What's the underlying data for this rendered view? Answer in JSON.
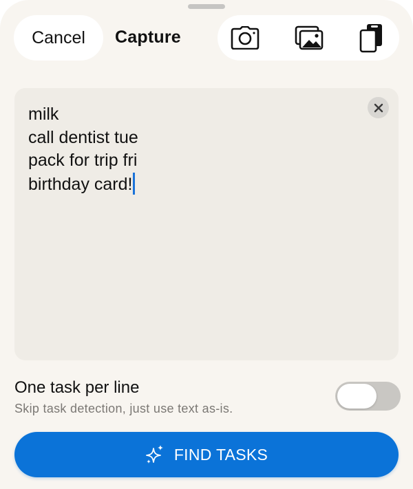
{
  "header": {
    "cancel_label": "Cancel",
    "title": "Capture",
    "tools": [
      {
        "name": "camera-icon"
      },
      {
        "name": "photo-library-icon"
      },
      {
        "name": "clipboard-paste-icon"
      }
    ]
  },
  "editor": {
    "text": "milk\ncall dentist tue\npack for trip fri\nbirthday card!",
    "clear_icon": "close-icon"
  },
  "option": {
    "label": "One task per line",
    "description": "Skip task detection, just use text as-is.",
    "enabled": false
  },
  "cta": {
    "label": "FIND TASKS",
    "icon": "sparkles-icon"
  },
  "colors": {
    "accent": "#0b73d8",
    "caret": "#1a73d9",
    "sheet_background": "#f8f5f0",
    "editor_background": "#efece6"
  }
}
